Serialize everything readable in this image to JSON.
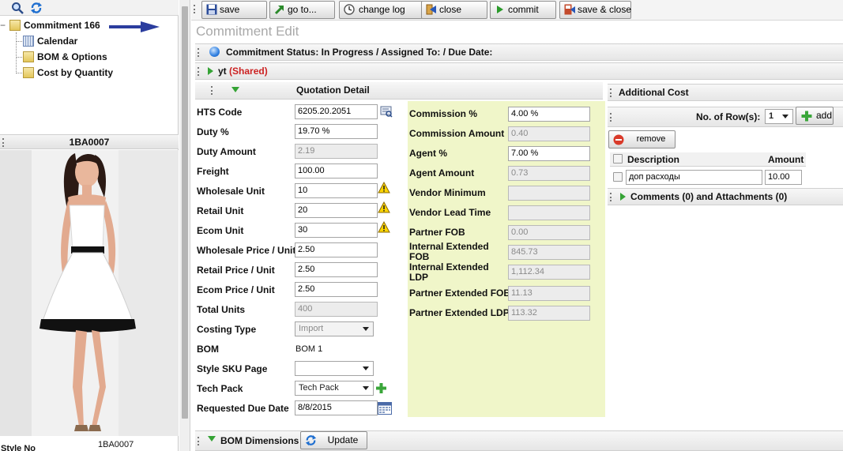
{
  "tree": {
    "root_label": "Commitment 166",
    "children": [
      "Calendar",
      "BOM & Options",
      "Cost by Quantity"
    ]
  },
  "style_panel": {
    "header": "1BA0007",
    "style_no_label": "Style No",
    "style_no_value": "1BA0007"
  },
  "toolbar": {
    "save": "save",
    "goto": "go to...",
    "change_log": "change log",
    "close": "close",
    "commit": "commit",
    "save_close": "save & close"
  },
  "page_title": "Commitment Edit",
  "status_bar": "Commitment Status: In Progress / Assigned To: / Due Date:",
  "shared_bar": {
    "name": "yt",
    "tag": "(Shared)"
  },
  "quotation": {
    "title": "Quotation Detail",
    "hts_code": {
      "label": "HTS Code",
      "value": "6205.20.2051"
    },
    "duty_pct": {
      "label": "Duty %",
      "value": "19.70 %"
    },
    "duty_amount": {
      "label": "Duty Amount",
      "value": "2.19"
    },
    "freight": {
      "label": "Freight",
      "value": "100.00"
    },
    "wholesale_unit": {
      "label": "Wholesale Unit",
      "value": "10"
    },
    "retail_unit": {
      "label": "Retail Unit",
      "value": "20"
    },
    "ecom_unit": {
      "label": "Ecom Unit",
      "value": "30"
    },
    "wholesale_price": {
      "label": "Wholesale Price / Unit",
      "value": "2.50"
    },
    "retail_price": {
      "label": "Retail Price / Unit",
      "value": "2.50"
    },
    "ecom_price": {
      "label": "Ecom Price / Unit",
      "value": "2.50"
    },
    "total_units": {
      "label": "Total Units",
      "value": "400"
    },
    "costing_type": {
      "label": "Costing Type",
      "value": "Import"
    },
    "bom": {
      "label": "BOM",
      "value": "BOM 1"
    },
    "style_sku_page": {
      "label": "Style SKU Page",
      "value": ""
    },
    "tech_pack": {
      "label": "Tech Pack",
      "value": "Tech Pack"
    },
    "requested_due_date": {
      "label": "Requested Due Date",
      "value": "8/8/2015"
    }
  },
  "costs": {
    "commission_pct": {
      "label": "Commission %",
      "value": "4.00 %"
    },
    "commission_amount": {
      "label": "Commission Amount",
      "value": "0.40"
    },
    "agent_pct": {
      "label": "Agent %",
      "value": "7.00 %"
    },
    "agent_amount": {
      "label": "Agent Amount",
      "value": "0.73"
    },
    "vendor_minimum": {
      "label": "Vendor Minimum",
      "value": ""
    },
    "vendor_lead_time": {
      "label": "Vendor Lead Time",
      "value": ""
    },
    "partner_fob": {
      "label": "Partner FOB",
      "value": "0.00"
    },
    "internal_ext_fob": {
      "label": "Internal Extended FOB",
      "value": "845.73"
    },
    "internal_ext_ldp": {
      "label": "Internal Extended LDP",
      "value": "1,112.34"
    },
    "partner_ext_fob": {
      "label": "Partner Extended FOB",
      "value": "11.13"
    },
    "partner_ext_ldp": {
      "label": "Partner Extended LDP",
      "value": "113.32"
    }
  },
  "additional_cost": {
    "title": "Additional Cost",
    "rows_label": "No. of Row(s):",
    "rows_value": "1",
    "add_label": "add",
    "remove_label": "remove",
    "col_description": "Description",
    "col_amount": "Amount",
    "rows": [
      {
        "description": "доп расходы",
        "amount": "10.00"
      }
    ]
  },
  "comments_bar": "Comments (0) and Attachments (0)",
  "bom_dimensions": {
    "title": "BOM Dimensions",
    "update_label": "Update"
  },
  "colors": {
    "panel_bg": "#f0f6c9",
    "shared_red": "#cc2222",
    "accent_green": "#35a335"
  }
}
